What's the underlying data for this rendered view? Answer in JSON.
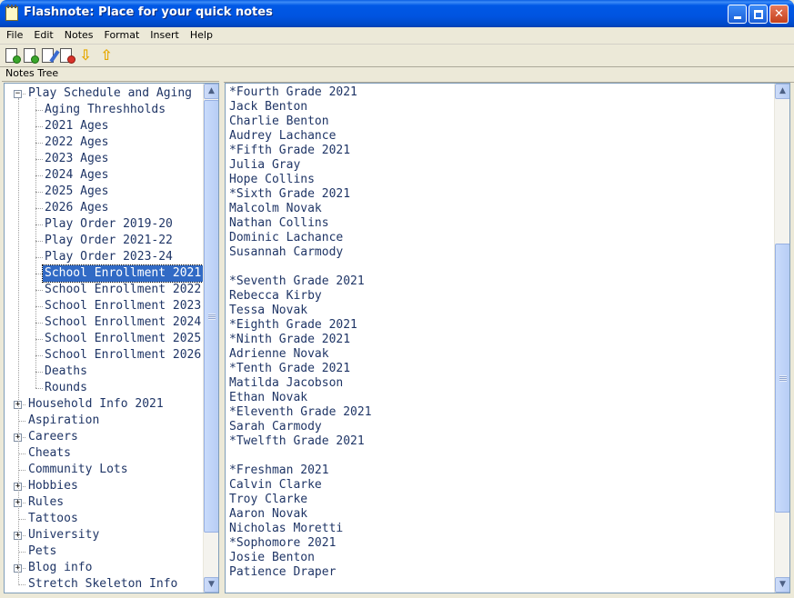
{
  "window": {
    "title": "Flashnote: Place for your quick notes",
    "buttons": {
      "minimize": "_",
      "maximize": "□",
      "close": "✕"
    }
  },
  "menu": [
    "File",
    "Edit",
    "Notes",
    "Format",
    "Insert",
    "Help"
  ],
  "toolbar": [
    {
      "name": "new-note-icon"
    },
    {
      "name": "new-subnote-icon"
    },
    {
      "name": "edit-note-icon"
    },
    {
      "name": "delete-note-icon"
    },
    {
      "name": "move-down-icon"
    },
    {
      "name": "move-up-icon"
    }
  ],
  "tree": {
    "header": "Notes Tree",
    "items": [
      {
        "label": "Play Schedule and Aging",
        "level": 0,
        "expander": "−"
      },
      {
        "label": "Aging Threshholds",
        "level": 1
      },
      {
        "label": "2021 Ages",
        "level": 1
      },
      {
        "label": "2022 Ages",
        "level": 1
      },
      {
        "label": "2023 Ages",
        "level": 1
      },
      {
        "label": "2024 Ages",
        "level": 1
      },
      {
        "label": "2025 Ages",
        "level": 1
      },
      {
        "label": "2026 Ages",
        "level": 1
      },
      {
        "label": "Play Order 2019-20",
        "level": 1
      },
      {
        "label": "Play Order 2021-22",
        "level": 1
      },
      {
        "label": "Play Order 2023-24",
        "level": 1
      },
      {
        "label": "School Enrollment 2021",
        "level": 1,
        "selected": true
      },
      {
        "label": "School Enrollment 2022",
        "level": 1
      },
      {
        "label": "School Enrollment 2023",
        "level": 1
      },
      {
        "label": "School Enrollment 2024",
        "level": 1
      },
      {
        "label": "School Enrollment 2025",
        "level": 1
      },
      {
        "label": "School Enrollment 2026",
        "level": 1
      },
      {
        "label": "Deaths",
        "level": 1
      },
      {
        "label": "Rounds",
        "level": 1
      },
      {
        "label": "Household Info 2021",
        "level": 0,
        "expander": "+"
      },
      {
        "label": "Aspiration",
        "level": 0
      },
      {
        "label": "Careers",
        "level": 0,
        "expander": "+"
      },
      {
        "label": "Cheats",
        "level": 0
      },
      {
        "label": "Community Lots",
        "level": 0
      },
      {
        "label": "Hobbies",
        "level": 0,
        "expander": "+"
      },
      {
        "label": "Rules",
        "level": 0,
        "expander": "+"
      },
      {
        "label": "Tattoos",
        "level": 0
      },
      {
        "label": "University",
        "level": 0,
        "expander": "+"
      },
      {
        "label": "Pets",
        "level": 0
      },
      {
        "label": "Blog info",
        "level": 0,
        "expander": "+"
      },
      {
        "label": "Stretch Skeleton Info",
        "level": 0
      }
    ]
  },
  "note": {
    "lines": [
      "*Fourth Grade 2021",
      "Jack Benton",
      "Charlie Benton",
      "Audrey Lachance",
      "*Fifth Grade 2021",
      "Julia Gray",
      "Hope Collins",
      "*Sixth Grade 2021",
      "Malcolm Novak",
      "Nathan Collins",
      "Dominic Lachance",
      "Susannah Carmody",
      "",
      "*Seventh Grade 2021",
      "Rebecca Kirby",
      "Tessa Novak",
      "*Eighth Grade 2021",
      "*Ninth Grade 2021",
      "Adrienne Novak",
      "*Tenth Grade 2021",
      "Matilda Jacobson",
      "Ethan Novak",
      "*Eleventh Grade 2021",
      "Sarah Carmody",
      "*Twelfth Grade 2021",
      "",
      "*Freshman 2021",
      "Calvin Clarke",
      "Troy Clarke",
      "Aaron Novak",
      "Nicholas Moretti",
      "*Sophomore 2021",
      "Josie Benton",
      "Patience Draper"
    ]
  },
  "scroll": {
    "tree_position": 0.0,
    "note_position": 0.55
  },
  "colors": {
    "text": "#1f3566",
    "selection": "#316ac5",
    "titlebar": "#0054e0"
  }
}
